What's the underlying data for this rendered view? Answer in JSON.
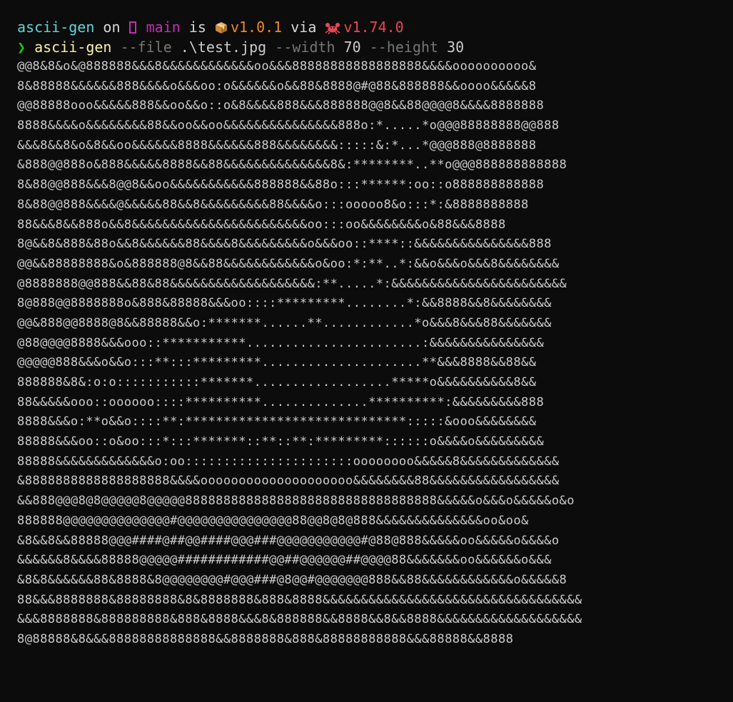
{
  "prompt": {
    "dir": "ascii-gen",
    "on": "on",
    "branch": "main",
    "is": "is",
    "version": "v1.0.1",
    "via": "via",
    "rust_version": "v1.74.0",
    "icons": [
      "git-branch-icon",
      "package-icon",
      "crab-icon"
    ],
    "colors": {
      "dir": "#61d6d6",
      "branch": "#c12fb2",
      "version": "#f08a20",
      "rust": "#e74856"
    }
  },
  "command": {
    "chevron": "❯",
    "name": "ascii-gen",
    "file_flag": "--file",
    "file_value": ".\\test.jpg",
    "width_flag": "--width",
    "width_value": "70",
    "height_flag": "--height",
    "height_value": "30"
  },
  "ascii_output": [
    "@@8&8&o&@888888&&&8&&&&&&&&&&&&oo&&&88888888888888888&&&&oooooooooo&",
    "8&88888&&&&&&888&&&&o&&&oo:o&&&&&&o&&88&8888@#@88&888888&&oooo&&&&&8",
    "@@88888ooo&&&&&888&&oo&&o::o&8&&&&888&&&888888@@8&&88@@@@8&&&&8888888",
    "8888&&&&o&&&&&&&&88&&oo&&oo&&&&&&&&&&&&&&&888o:*.....*o@@@88888888@@888",
    "&&&8&&8&o&8&&oo&&&&&&8888&&&&&&888&&&&&&&&:::::&:*...*@@@888@8888888",
    "&888@@888o&888&&&&&8888&&88&&&&&&&&&&&&&&8&:********..**o@@@888888888888",
    "8&88@@888&&&8@@8&&oo&&&&&&&&&&&888888&&88o:::******:oo::o888888888888",
    "8&88@@888&&&&@&&&&&88&&8&&&&&&&&&88&&&&o:::ooooo8&o:::*:&8888888888",
    "88&&&8&&888o&&8&&&&&&&&&&&&&&&&&&&&&&&oo:::oo&&&&&&&&o&88&&&8888",
    "8@&&8&888&88o&&8&&&&&&88&&&&8&&&&&&&&&o&&&oo::****::&&&&&&&&&&&&&&&888",
    "@@&&88888888&o&888888@8&&88&&&&&&&&&&&&o&oo:*:**..*:&&o&&&o&&&8&&&&&&&&",
    "@8888888@@888&&88&88&&&&&&&&&&&&&&&&&&&:**.....*:&&&&&&&&&&&&&&&&&&&&&&&",
    "8@888@@8888888o&888&88888&&&oo::::*********........*:&&8888&&8&&&&&&&&",
    "@@&888@@8888@8&&88888&&o:*******......**............*o&&&8&&&88&&&&&&&",
    "@88@@@@8888&&&ooo::***********.......................:&&&&&&&&&&&&&&&",
    "@@@@@888&&&o&&o:::**:::*********.....................**&&&8888&&88&&",
    "888888&8&:o:o:::::::::::*******..................*****o&&&&&&&&&&8&&",
    "88&&&&&ooo::oooooo::::**********..............**********:&&&&&&&&&888",
    "8888&&&o:**o&&o::::**:*****************************:::::&ooo&&&&&&&&",
    "88888&&&oo::o&oo:::*:::*******::**::**:*********::::::o&&&&o&&&&&&&&&",
    "88888&&&&&&&&&&&&&o:oo::::::::::::::::::::::oooooooo&&&&&8&&&&&&&&&&&&&",
    "&8888888888888888888&&&&oooooooooooooooooooo&&&&&&&&88&&&&&&&&&&&&&&&&&",
    "&&888@@@8@8@@@@@8@@@@@888888888888888888888888888888888&&&&&o&&&o&&&&&o&o",
    "888888@@@@@@@@@@@@@@#@@@@@@@@@@@@@@@88@@8@8@888&&&&&&&&&&&&&&oo&oo&",
    "&8&&8&&88888@@@####@##@@####@@@###@@@@@@@@@@@#@88@888&&&&&oo&&&&&o&&&&o",
    "&&&&&&8&&&&88888@@@@@############@@##@@@@@@##@@@@88&&&&&&&oo&&&&&&o&&&",
    "&8&8&&&&&&88&8888&8@@@@@@@@#@@@###@8@@#@@@@@@@888&&88&&&&&&&&&&&&o&&&&&8",
    "88&&&8888888&88888888&8&8888888&888&8888&&&&&&&&&&&&&&&&&&&&&&&&&&&&&&&&&&",
    "&&&8888888&888888888&888&8888&&&8&888888&&8888&&8&&8888&&&&&&&&&&&&&&&&&&&",
    "8@88888&8&&&88888888888888&&8888888&888&88888888888&&&88888&&8888"
  ]
}
